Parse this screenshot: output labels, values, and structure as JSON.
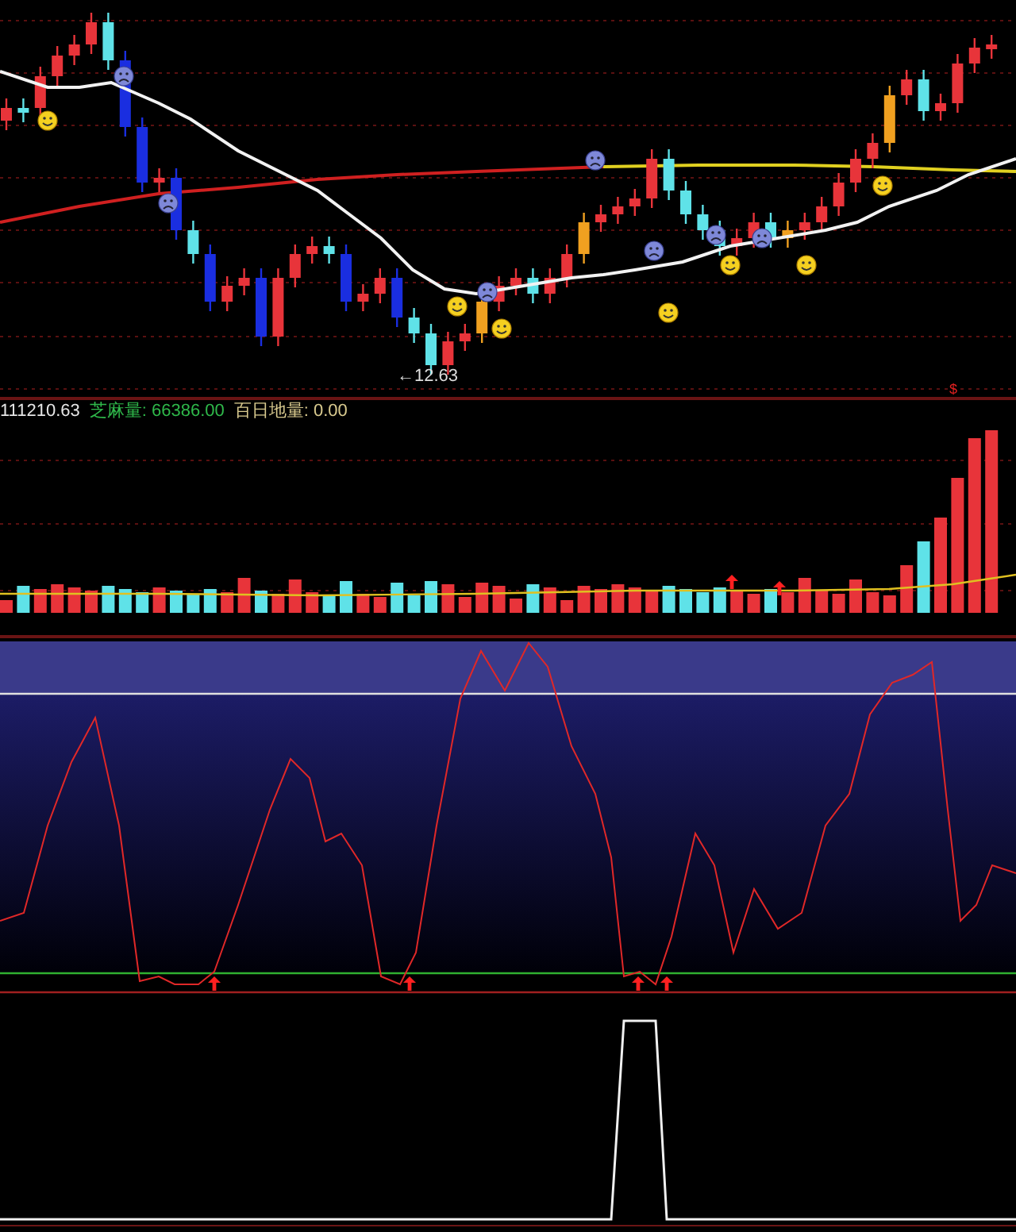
{
  "price_panel": {
    "low_marker": "←12.63",
    "signal_mark": "$"
  },
  "volume_panel": {
    "readout": "111210.63",
    "indicators": [
      {
        "text": "芝麻量: 66386.00",
        "color": "#2fb84a"
      },
      {
        "text": "百日地量: 0.00",
        "color": "#d8c98e"
      }
    ]
  }
}
